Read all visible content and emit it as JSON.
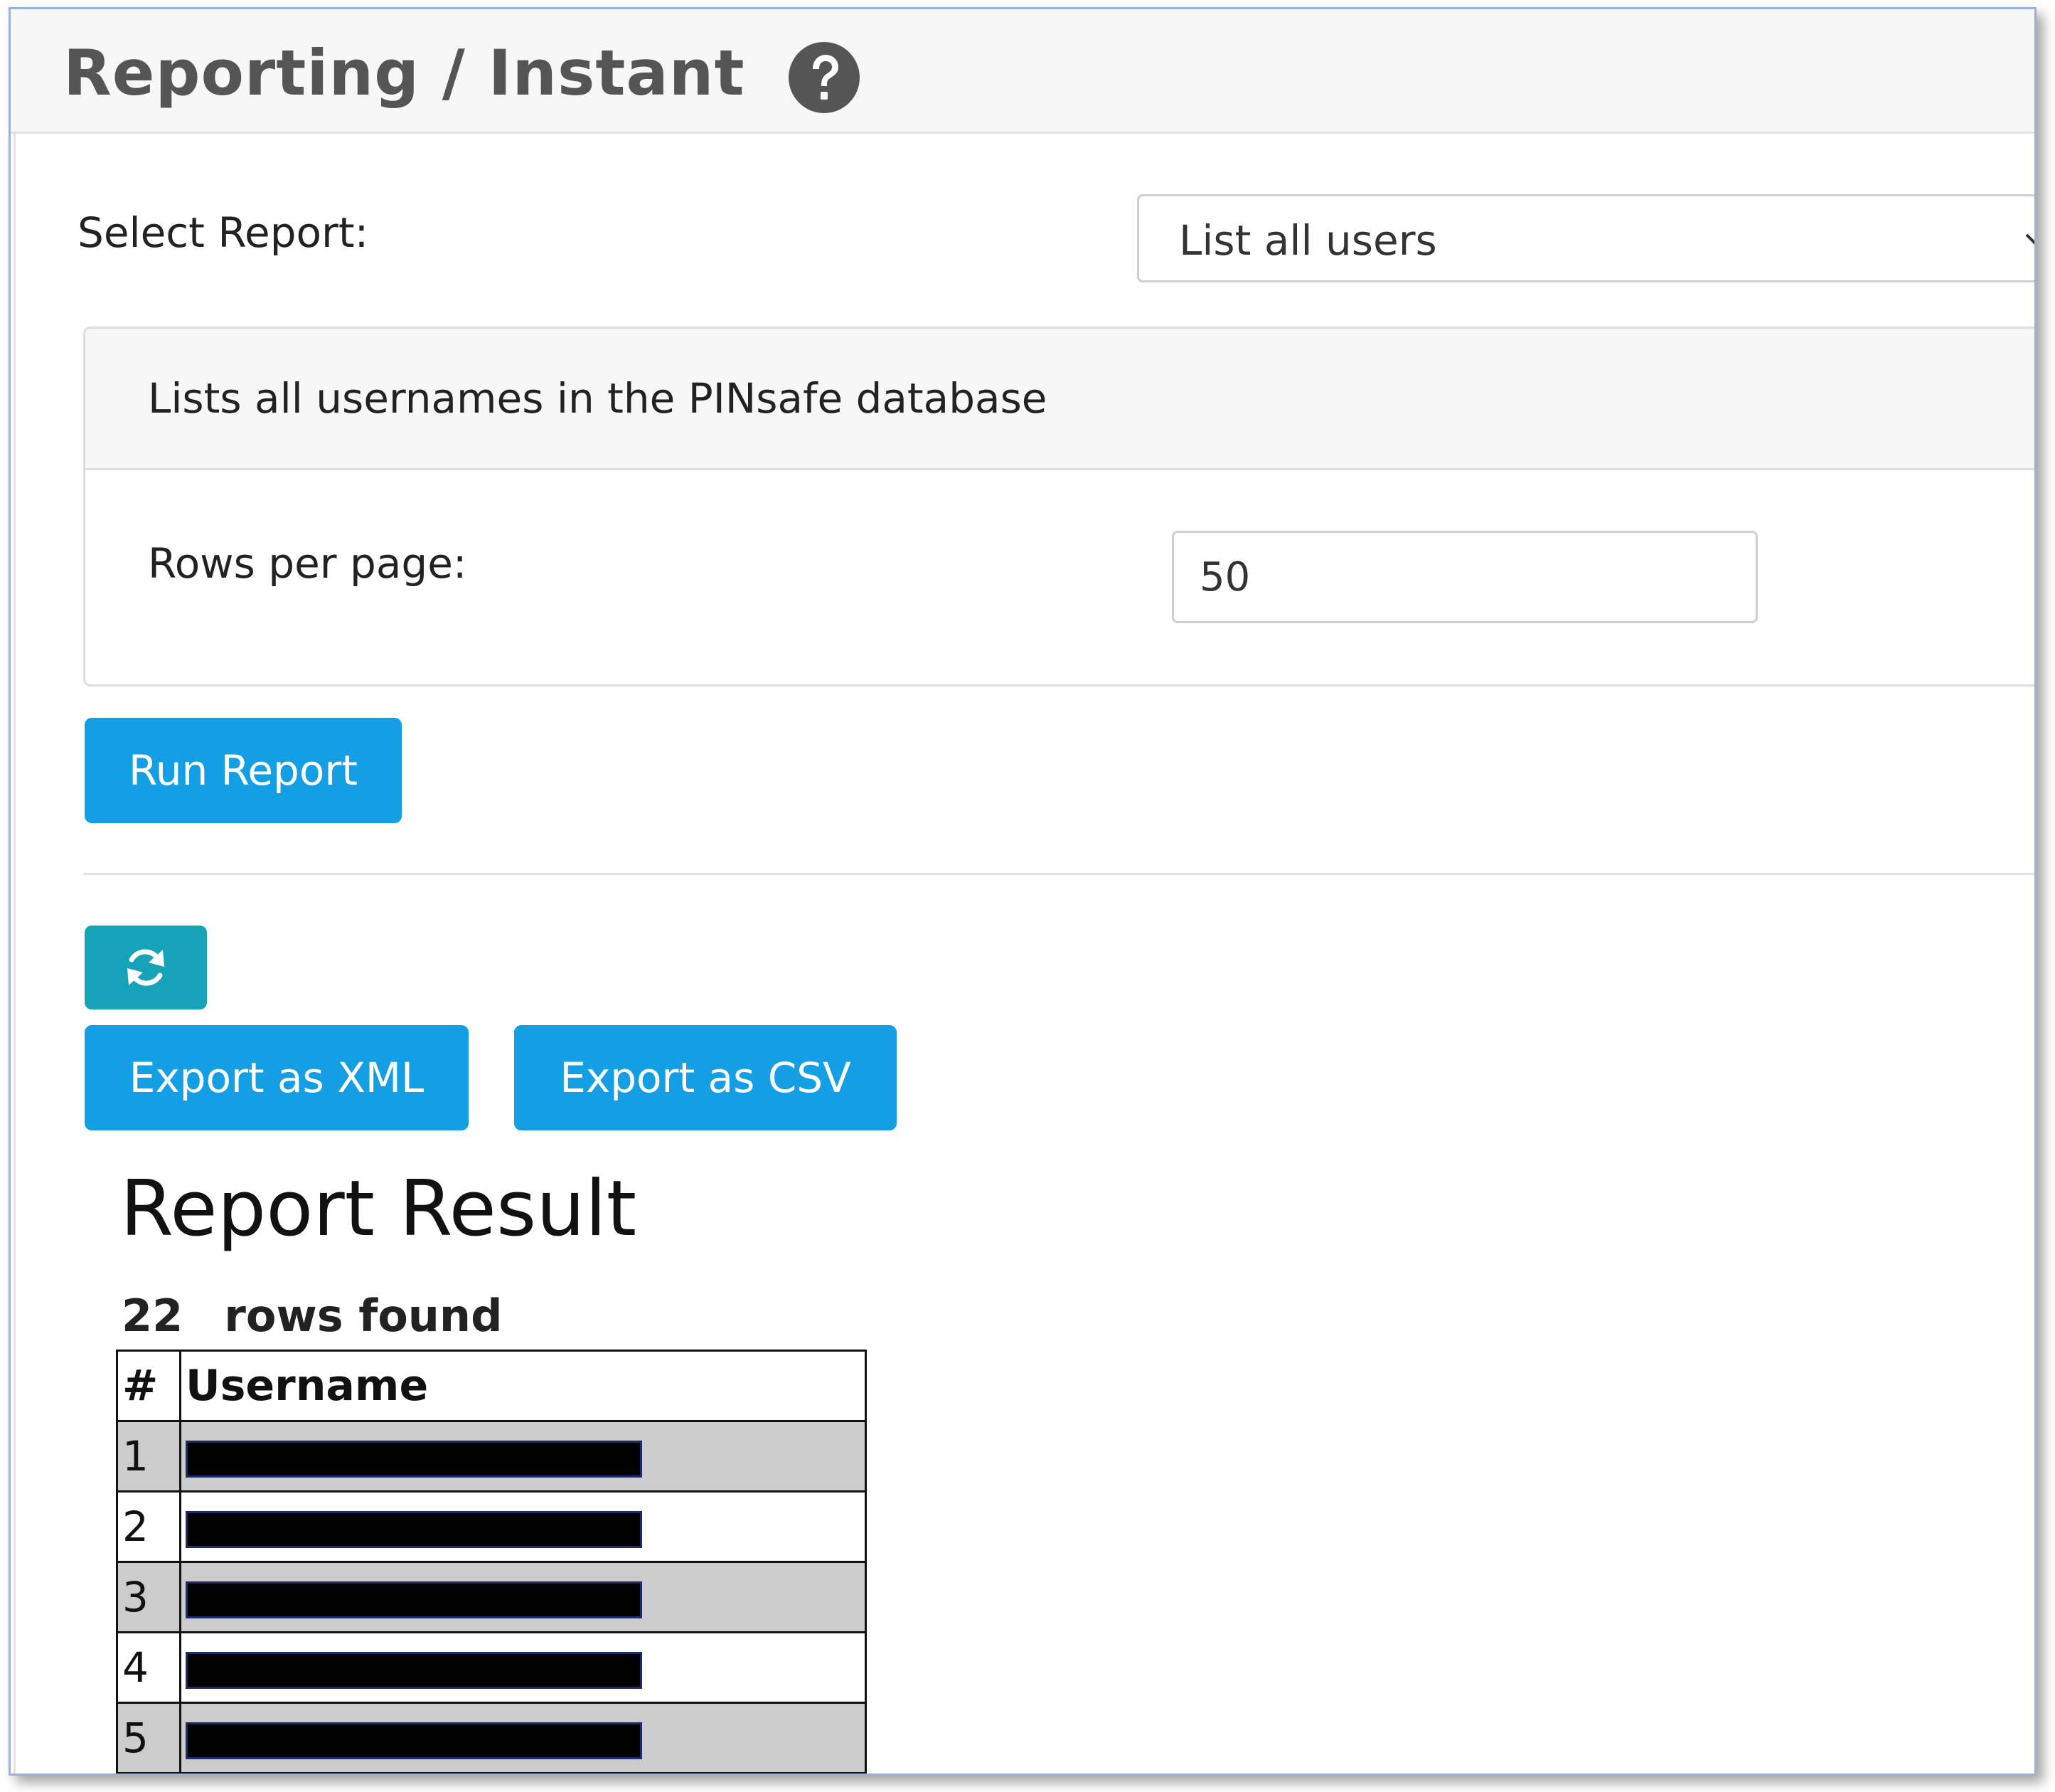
{
  "header": {
    "title": "Reporting / Instant",
    "help_icon": "question-circle-icon"
  },
  "form": {
    "select_label": "Select Report:",
    "selected_report": "List all users",
    "description": "Lists all usernames in the PINsafe database",
    "rows_label": "Rows per page:",
    "rows_value": "50",
    "run_label": "Run Report"
  },
  "actions": {
    "refresh_icon": "refresh-icon",
    "export_xml_label": "Export as XML",
    "export_csv_label": "Export as CSV"
  },
  "result": {
    "title": "Report Result",
    "count": "22",
    "count_label": "rows found",
    "columns": [
      "#",
      "Username"
    ],
    "rows": [
      {
        "num": "1",
        "username": "[redacted]"
      },
      {
        "num": "2",
        "username": "[redacted]"
      },
      {
        "num": "3",
        "username": "[redacted]"
      },
      {
        "num": "4",
        "username": "[redacted]"
      },
      {
        "num": "5",
        "username": "[redacted]"
      }
    ]
  },
  "colors": {
    "primary_button": "#149ee3",
    "refresh_button": "#16a2b8",
    "header_bg": "#f7f7f7",
    "title_text": "#555555"
  }
}
